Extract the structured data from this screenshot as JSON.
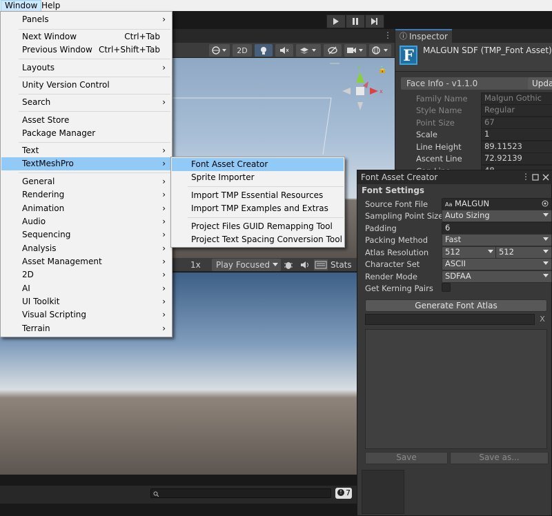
{
  "menubar": {
    "window": "Window",
    "help": "Help"
  },
  "window_menu": {
    "items": [
      {
        "label": "Panels",
        "shortcut": "",
        "arrow": true
      },
      {
        "label": "Next Window",
        "shortcut": "Ctrl+Tab",
        "arrow": false
      },
      {
        "label": "Previous Window",
        "shortcut": "Ctrl+Shift+Tab",
        "arrow": false
      },
      {
        "label": "Layouts",
        "shortcut": "",
        "arrow": true
      },
      {
        "label": "Unity Version Control",
        "shortcut": "",
        "arrow": false
      },
      {
        "label": "Search",
        "shortcut": "",
        "arrow": true
      },
      {
        "label": "Asset Store",
        "shortcut": "",
        "arrow": false
      },
      {
        "label": "Package Manager",
        "shortcut": "",
        "arrow": false
      },
      {
        "label": "Text",
        "shortcut": "",
        "arrow": true
      },
      {
        "label": "TextMeshPro",
        "shortcut": "",
        "arrow": true
      },
      {
        "label": "General",
        "shortcut": "",
        "arrow": true
      },
      {
        "label": "Rendering",
        "shortcut": "",
        "arrow": true
      },
      {
        "label": "Animation",
        "shortcut": "",
        "arrow": true
      },
      {
        "label": "Audio",
        "shortcut": "",
        "arrow": true
      },
      {
        "label": "Sequencing",
        "shortcut": "",
        "arrow": true
      },
      {
        "label": "Analysis",
        "shortcut": "",
        "arrow": true
      },
      {
        "label": "Asset Management",
        "shortcut": "",
        "arrow": true
      },
      {
        "label": "2D",
        "shortcut": "",
        "arrow": true
      },
      {
        "label": "AI",
        "shortcut": "",
        "arrow": true
      },
      {
        "label": "UI Toolkit",
        "shortcut": "",
        "arrow": true
      },
      {
        "label": "Visual Scripting",
        "shortcut": "",
        "arrow": true
      },
      {
        "label": "Terrain",
        "shortcut": "",
        "arrow": true
      }
    ]
  },
  "textmeshpro_submenu": {
    "items": [
      "Font Asset Creator",
      "Sprite Importer",
      "Import TMP Essential Resources",
      "Import TMP Examples and Extras",
      "Project Files GUID Remapping Tool",
      "Project Text Spacing Conversion Tool"
    ]
  },
  "scene_toolbar": {
    "mode_2d": "2D"
  },
  "game_toolbar": {
    "scale": "1x",
    "play_mode": "Play Focused",
    "stats": "Stats"
  },
  "console": {
    "count": "7"
  },
  "inspector": {
    "tab": "Inspector",
    "title": "MALGUN SDF (TMP_Font Asset)",
    "icon_letter": "F",
    "face_info": "Face Info - v1.1.0",
    "update": "Upda",
    "fields": [
      {
        "label": "Family Name",
        "value": "Malgun Gothic"
      },
      {
        "label": "Style Name",
        "value": "Regular"
      },
      {
        "label": "Point Size",
        "value": "67"
      },
      {
        "label": "Scale",
        "value": "1"
      },
      {
        "label": "Line Height",
        "value": "89.11523"
      },
      {
        "label": "Ascent Line",
        "value": "72.92139"
      },
      {
        "label": "Cap Line",
        "value": "48"
      }
    ]
  },
  "font_asset_creator": {
    "title": "Font Asset Creator",
    "section": "Font Settings",
    "source_font_label": "Source Font File",
    "source_font_value": "MALGUN",
    "source_font_badge": "Aa",
    "sampling_label": "Sampling Point Size",
    "sampling_value": "Auto Sizing",
    "padding_label": "Padding",
    "padding_value": "6",
    "packing_label": "Packing Method",
    "packing_value": "Fast",
    "atlas_label": "Atlas Resolution",
    "atlas_w": "512",
    "atlas_h": "512",
    "charset_label": "Character Set",
    "charset_value": "ASCII",
    "render_label": "Render Mode",
    "render_value": "SDFAA",
    "kerning_label": "Get Kerning Pairs",
    "generate": "Generate Font Atlas",
    "clear": "X",
    "save": "Save",
    "save_as": "Save as..."
  }
}
